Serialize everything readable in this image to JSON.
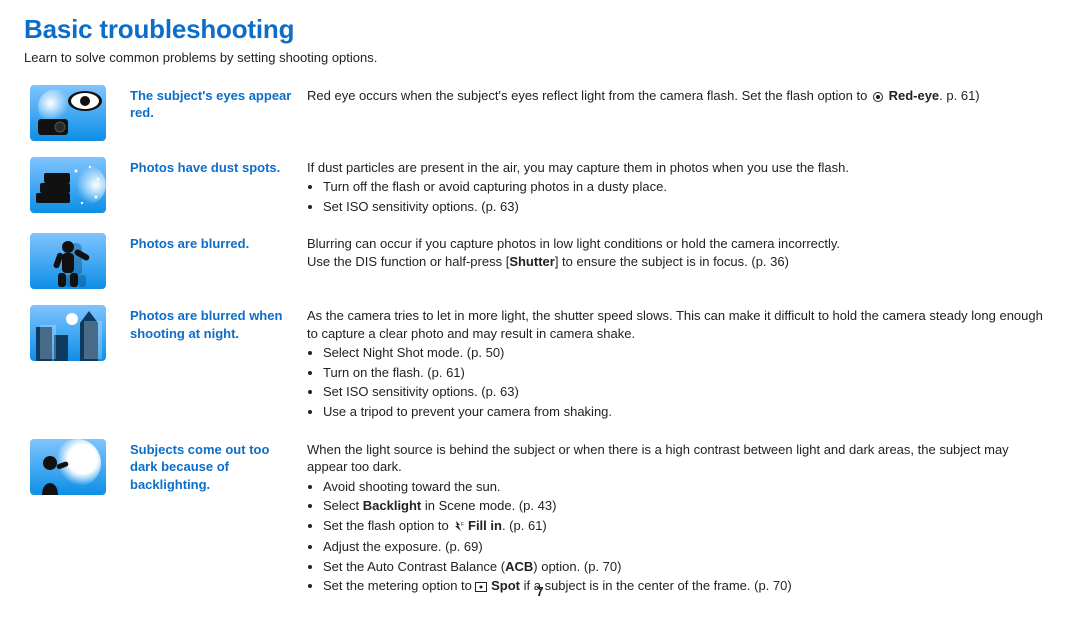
{
  "title": "Basic troubleshooting",
  "subtitle": "Learn to solve common problems by setting shooting options.",
  "page_number": "7",
  "rows": [
    {
      "label": "The subject's eyes appear red.",
      "body": "Red eye occurs when the subject's eyes reflect light from the camera flash. Set the flash option to",
      "body_tail": ". p. 61)",
      "bold1": "Red-eye",
      "icon": "eye"
    },
    {
      "label": "Photos have dust spots.",
      "body": "If dust particles are present in the air, you may capture them in photos when you use the flash.",
      "bullets": [
        "Turn off the flash or avoid capturing photos in a dusty place.",
        "Set ISO sensitivity options. (p. 63)"
      ],
      "icon": "dust"
    },
    {
      "label": "Photos are blurred.",
      "body": "Blurring can occur if you capture photos in low light conditions or hold the camera incorrectly.",
      "body2a": "Use the DIS function or half-press [",
      "body2b": "Shutter",
      "body2c": "] to ensure the subject is in focus. (p. 36)",
      "icon": "blur"
    },
    {
      "label": "Photos are blurred when shooting at night.",
      "body": "As the camera tries to let in more light, the shutter speed slows. This can make it difficult to hold the camera steady long enough to capture a clear photo and may result in camera shake.",
      "bullets": [
        "Select Night Shot mode. (p. 50)",
        "Turn on the flash. (p. 61)",
        "Set ISO sensitivity options. (p. 63)",
        "Use a tripod to prevent your camera from shaking."
      ],
      "icon": "night"
    },
    {
      "label": "Subjects come out too dark because of backlighting.",
      "body": "When the light source is behind the subject or when there is a high contrast between light and dark areas, the subject may appear too dark.",
      "bullets_rich": {
        "b1": "Avoid shooting toward the sun.",
        "b2a": "Select ",
        "b2b": "Backlight",
        "b2c": " in Scene mode. (p. 43)",
        "b3a": "Set the flash option to ",
        "b3b": "Fill in",
        "b3c": ". (p. 61)",
        "b4": "Adjust the exposure. (p. 69)",
        "b5a": "Set the Auto Contrast Balance (",
        "b5b": "ACB",
        "b5c": ") option. (p. 70)",
        "b6a": "Set the metering option to ",
        "b6b": "Spot",
        "b6c": " if a subject is in the center of the frame. (p. 70)"
      },
      "icon": "backlight"
    }
  ]
}
